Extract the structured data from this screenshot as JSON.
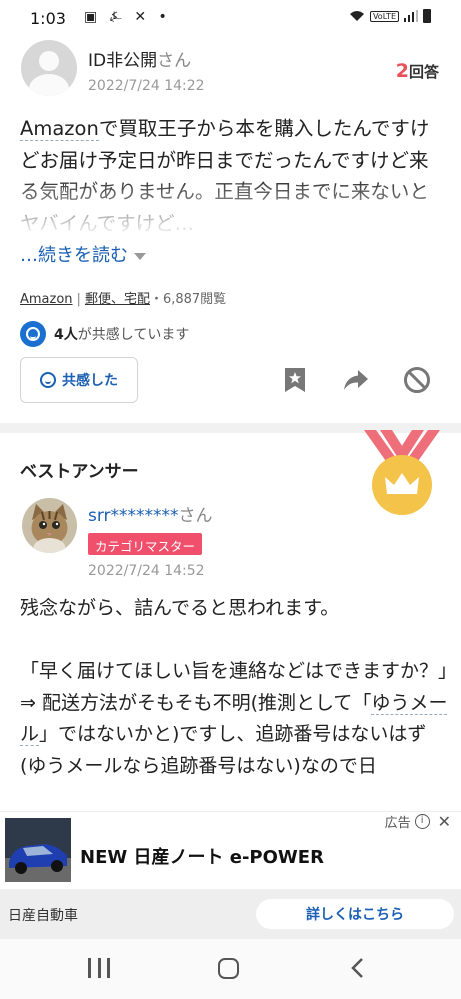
{
  "status_bar": {
    "time": "1:03",
    "left_icons": "▣ ⍼ ✕ •",
    "network": "VoLTE"
  },
  "question": {
    "asker": "ID非公開",
    "asker_suffix": "さん",
    "date": "2022/7/24 14:22",
    "answers_count": "2",
    "answers_label": "回答",
    "body_keyword": "Amazon",
    "body_rest": "で買取王子から本を購入したんですけどお届け予定日が昨日までだったんですけど来る気配がありません。正直今日までに来ないとヤバイんですけど…",
    "read_more": "…続きを読む",
    "category_main": "Amazon",
    "category_sep": "|",
    "category_sub": "郵便、宅配",
    "views": "・6,887閲覧",
    "empathy_count": "4人",
    "empathy_text": "が共感しています",
    "empathy_button": "共感した"
  },
  "best_answer": {
    "section_title": "ベストアンサー",
    "answerer": "srr********",
    "answerer_suffix": "さん",
    "badge": "カテゴリマスター",
    "date": "2022/7/24 14:52",
    "p1": "残念ながら、詰んでると思われます。",
    "p2": "「早く届けてほしい旨を連絡などはできますか？」",
    "p3_a": "⇒ 配送方法がそもそも不明(推測として「",
    "p3_keyword": "ゆうメール",
    "p3_b": "」ではないかと)ですし、追跡番号はないはず(ゆうメールなら追跡番号はない)なので日"
  },
  "ad": {
    "label": "広告",
    "headline": "NEW 日産ノート e-POWER",
    "advertiser": "日産自動車",
    "cta": "詳しくはこちら"
  },
  "colors": {
    "accent_blue": "#1a5fb4",
    "answer_red": "#e9505a",
    "badge_pink": "#f0506b",
    "medal_ribbon": "#ee6e7a",
    "medal_gold": "#f4c34a"
  }
}
